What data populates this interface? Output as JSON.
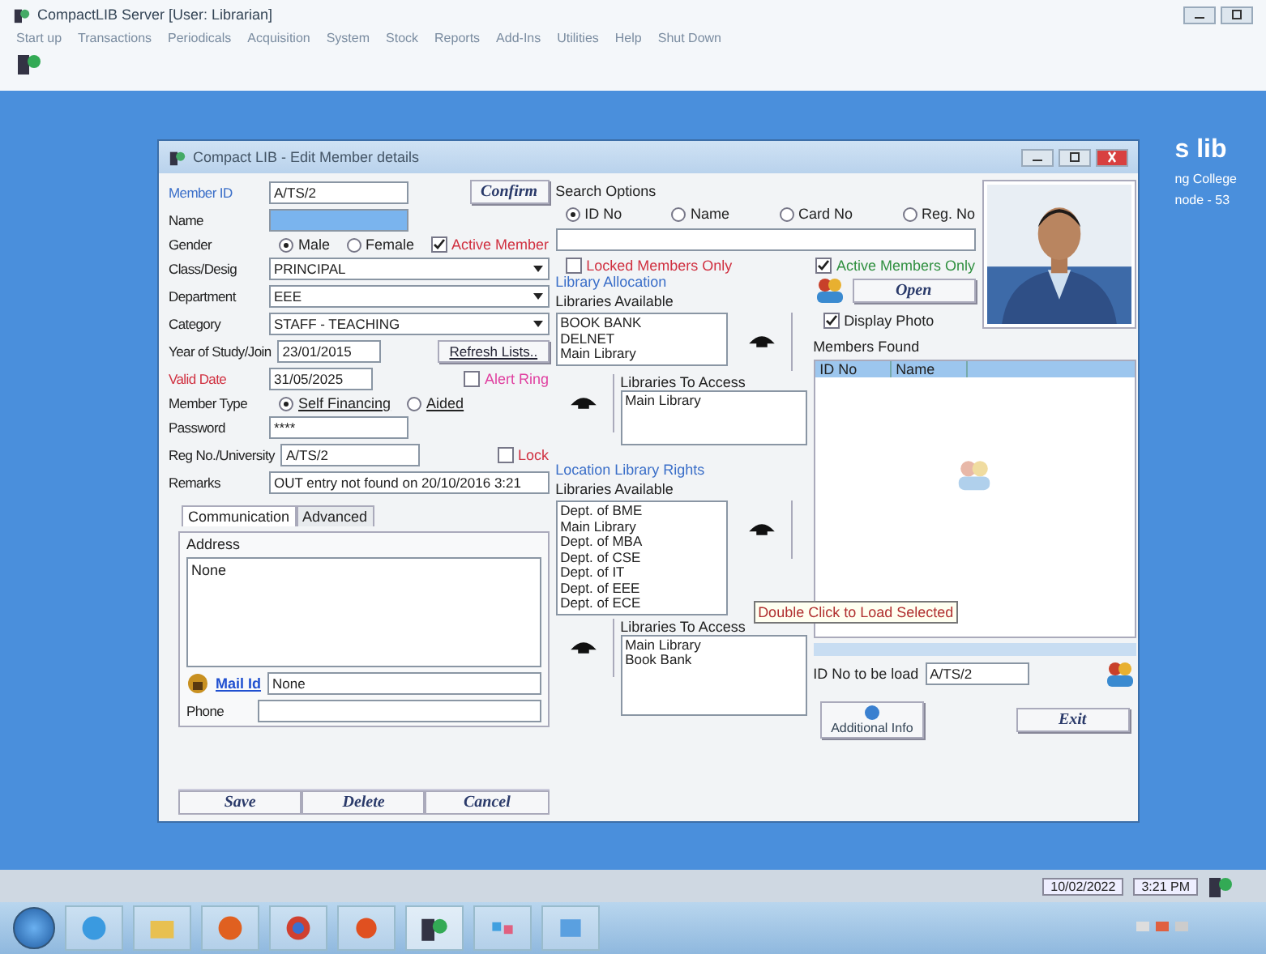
{
  "app": {
    "title": "CompactLIB Server [User: Librarian]",
    "menu": [
      "Start up",
      "Transactions",
      "Periodicals",
      "Acquisition",
      "System",
      "Stock",
      "Reports",
      "Add-Ins",
      "Utilities",
      "Help",
      "Shut Down"
    ]
  },
  "background_text": [
    "s lib",
    "ng College",
    "node - 53"
  ],
  "dialog": {
    "title": "Compact LIB - Edit Member details",
    "member_id": {
      "label": "Member ID",
      "value": "A/TS/2"
    },
    "confirm": "Confirm",
    "name_label": "Name",
    "gender": {
      "label": "Gender",
      "options": [
        {
          "label": "Male",
          "selected": true
        },
        {
          "label": "Female",
          "selected": false
        }
      ]
    },
    "active_member": {
      "label": "Active Member",
      "checked": true
    },
    "selects": [
      {
        "label": "Class/Desig",
        "value": "PRINCIPAL"
      },
      {
        "label": "Department",
        "value": "EEE"
      },
      {
        "label": "Category",
        "value": "STAFF - TEACHING"
      }
    ],
    "year": {
      "label": "Year of Study/Join",
      "value": "23/01/2015"
    },
    "refresh": "Refresh Lists..",
    "valid_date": {
      "label": "Valid Date",
      "value": "31/05/2025"
    },
    "alert": {
      "label": "Alert Ring",
      "checked": false
    },
    "member_type": {
      "label": "Member Type",
      "options": [
        {
          "label": "Self Financing",
          "selected": true
        },
        {
          "label": "Aided",
          "selected": false
        }
      ]
    },
    "password": {
      "label": "Password",
      "value": "****"
    },
    "reg_no": {
      "label": "Reg No./University",
      "value": "A/TS/2"
    },
    "lock": {
      "label": "Lock",
      "checked": false
    },
    "remarks": {
      "label": "Remarks",
      "value": "OUT entry not found on 20/10/2016 3:21"
    },
    "tabs": [
      {
        "label": "Communication",
        "selected": true
      },
      {
        "label": "Advanced",
        "selected": false
      }
    ],
    "address": {
      "label": "Address",
      "value": "None"
    },
    "mail": {
      "label": "Mail Id",
      "value": "None"
    },
    "phone": {
      "label": "Phone"
    },
    "buttons": [
      "Save",
      "Delete",
      "Cancel"
    ],
    "search": {
      "label": "Search Options",
      "options": [
        {
          "label": "ID No",
          "selected": true
        },
        {
          "label": "Name",
          "selected": false
        },
        {
          "label": "Card No",
          "selected": false
        },
        {
          "label": "Reg. No",
          "selected": false
        }
      ],
      "locked": {
        "label": "Locked Members Only",
        "checked": false
      },
      "active_only": {
        "label": "Active Members Only",
        "checked": true
      },
      "open": "Open",
      "display_photo": {
        "label": "Display Photo",
        "checked": true
      }
    },
    "library_allocation": {
      "label": "Library Allocation",
      "available_label": "Libraries Available",
      "available": [
        "BOOK BANK",
        "DELNET",
        "Main Library"
      ],
      "access_label": "Libraries To Access",
      "access": [
        "Main Library"
      ]
    },
    "location_rights": {
      "label": "Location Library Rights",
      "available_label": "Libraries Available",
      "available": [
        "Dept. of BME",
        "Main Library",
        "Dept. of MBA",
        "Dept. of CSE",
        "Dept. of IT",
        "Dept. of EEE",
        "Dept. of ECE"
      ],
      "access_label": "Libraries To Access",
      "access": [
        "Main Library",
        "Book Bank"
      ]
    },
    "members_found": {
      "label": "Members Found",
      "columns": [
        "ID No",
        "Name"
      ]
    },
    "tooltip": "Double Click to Load Selected",
    "id_to_load": {
      "label": "ID No to be load",
      "value": "A/TS/2"
    },
    "additional_info": "Additional Info",
    "exit": "Exit"
  },
  "status": {
    "date": "10/02/2022",
    "time": "3:21 PM"
  }
}
